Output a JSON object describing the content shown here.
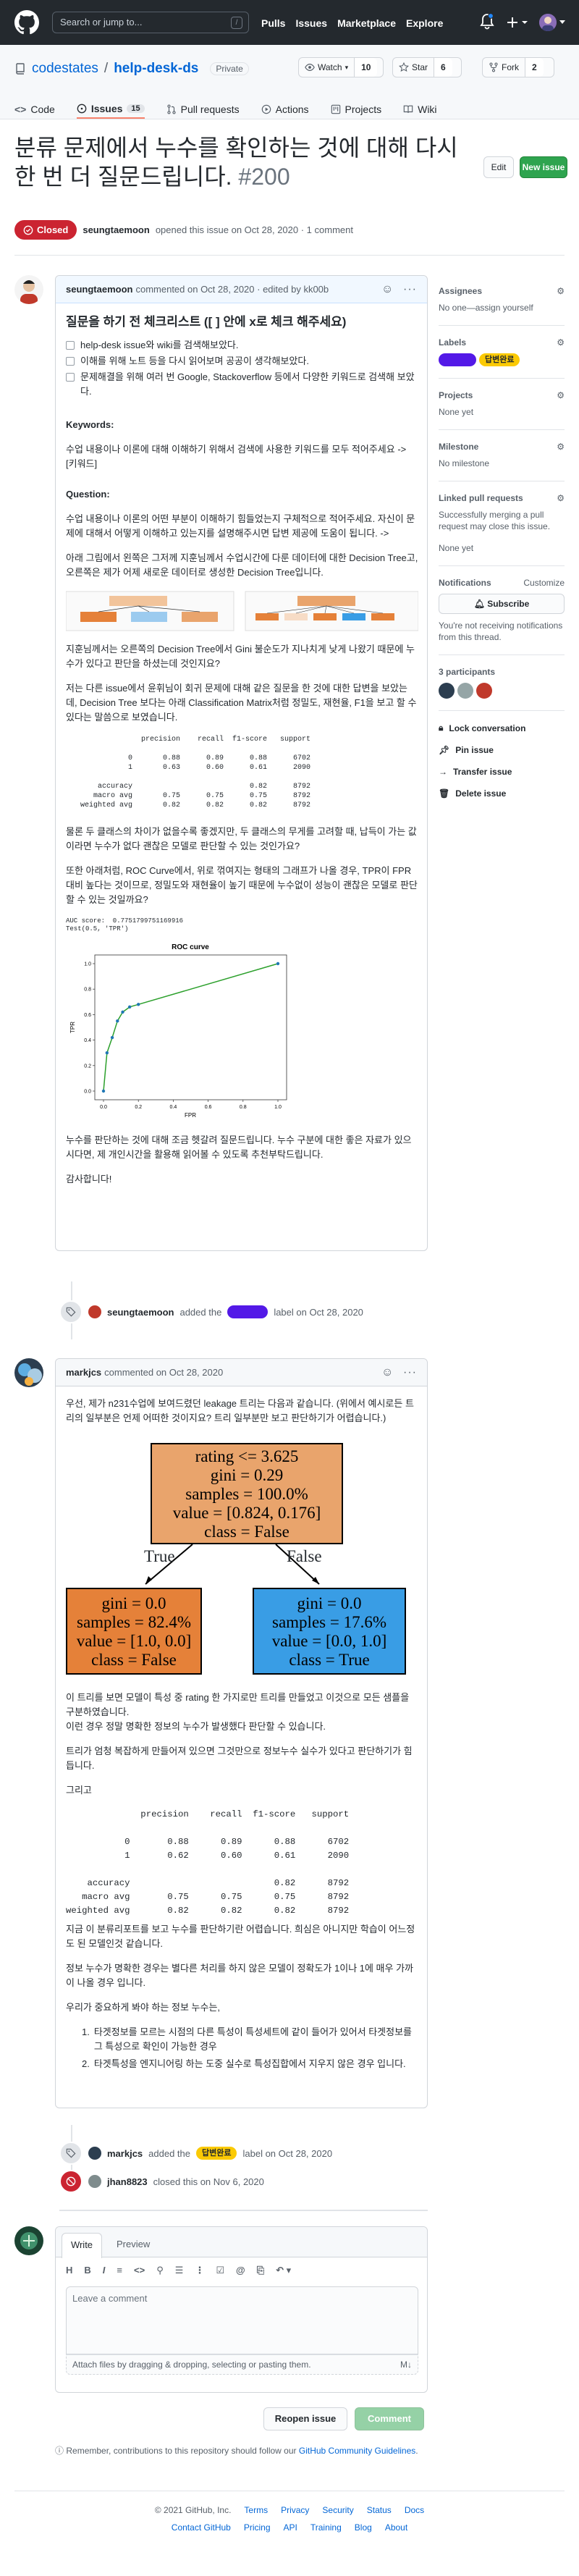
{
  "header": {
    "search_placeholder": "Search or jump to...",
    "slash_key": "/",
    "nav": [
      "Pulls",
      "Issues",
      "Marketplace",
      "Explore"
    ]
  },
  "repo": {
    "owner": "codestates",
    "separator": "/",
    "name": "help-desk-ds",
    "visibility": "Private",
    "watch_label": "Watch",
    "watch_count": "10",
    "star_label": "Star",
    "star_count": "6",
    "fork_label": "Fork",
    "fork_count": "2",
    "tabs": [
      {
        "label": "Code",
        "count": ""
      },
      {
        "label": "Issues",
        "count": "15"
      },
      {
        "label": "Pull requests",
        "count": ""
      },
      {
        "label": "Actions",
        "count": ""
      },
      {
        "label": "Projects",
        "count": ""
      },
      {
        "label": "Wiki",
        "count": ""
      }
    ]
  },
  "issue": {
    "title": "분류 문제에서 누수를 확인하는 것에 대해 다시한 번 더 질문드립니다.",
    "number": "#200",
    "edit_label": "Edit",
    "new_issue_label": "New issue",
    "state": "Closed",
    "author": "seungtaemoon",
    "meta": "opened this issue on Oct 28, 2020 · 1 comment"
  },
  "comment1": {
    "author": "seungtaemoon",
    "meta": "commented on Oct 28, 2020 · edited by kk00b",
    "heading": "질문을 하기 전 체크리스트 ([ ] 안에 x로 체크 해주세요)",
    "checklist": [
      "help-desk issue와 wiki를 검색해보았다.",
      "이해를 위해 노트 등을 다시 읽어보며 공공이 생각해보았다.",
      "문제해결을 위해 여러 번 Google, Stackoverflow 등에서 다양한 키워드로 검색해 보았다."
    ],
    "keywords_label": "Keywords:",
    "keywords_text": "수업 내용이나 이론에 대해 이해하기 위해서 검색에 사용한 키워드를 모두 적어주세요 -> [키워드]",
    "question_label": "Question:",
    "q1": "수업 내용이나 이론의 어떤 부분이 이해하기 힘들었는지 구체적으로 적어주세요. 자신이 문제에 대해서 어떻게 이해하고 있는지를 설명해주시면 답변 제공에 도움이 됩니다. ->",
    "q2": "아래 그림에서 왼쪽은 그저께 지훈님께서 수업시간에 다룬 데이터에 대한 Decision Tree고, 오른쪽은 제가 어제 새로운 데이터로 생성한 Decision Tree입니다.",
    "q3": "지훈님께서는 오른쪽의 Decision Tree에서 Gini 불순도가 지나치게 낮게 나왔기 때문에 누수가 있다고 판단을 하셨는데 것인지요?",
    "q4": "저는 다른 issue에서 윤휘님이 회귀 문제에 대해 같은 질문을 한 것에 대한 답변을 보았는데, Decision Tree 보다는 아래 Classification Matrix처럼 정밀도, 재현율, F1을 보고 할 수 있다는 말씀으로 보였습니다.",
    "report": "              precision    recall  f1-score   support\n\n           0       0.88      0.89      0.88      6702\n           1       0.63      0.60      0.61      2090\n\n    accuracy                           0.82      8792\n   macro avg       0.75      0.75      0.75      8792\nweighted avg       0.82      0.82      0.82      8792",
    "q5": "물론 두 클래스의 차이가 없을수록 좋겠지만, 두 클래스의 무게를 고려할 때, 납득이 가는 값이라면 누수가 없다 괜찮은 모델로 판단할 수 있는 것인가요?",
    "q6": "또한 아래처럼, ROC Curve에서, 위로 꺾여지는 형태의 그래프가 나올 경우, TPR이 FPR대비 높다는 것이므로, 정밀도와 재현율이 높기 때문에 누수없이 성능이 괜찮은 모델로 판단할 수 있는 것일까요?",
    "roc_output": "AUC score:  0.7751799751169916\nTest(0.5, 'TPR')",
    "q7": "누수를 판단하는 것에 대해 조금 헷갈려 질문드립니다. 누수 구분에 대한 좋은 자료가 있으시다면, 제 개인시간을 활용해 읽어볼 수 있도록 추천부탁드립니다.",
    "thanks": "감사합니다!"
  },
  "roc_chart": {
    "chart_data": {
      "type": "line",
      "title": "ROC curve",
      "xlabel": "FPR",
      "ylabel": "TPR",
      "xlim": [
        0,
        1
      ],
      "ylim": [
        0,
        1
      ],
      "xticks": [
        "0.0",
        "0.2",
        "0.4",
        "0.6",
        "0.8",
        "1.0"
      ],
      "yticks": [
        "0.0",
        "0.2",
        "0.4",
        "0.6",
        "0.8",
        "1.0"
      ],
      "x": [
        0.0,
        0.02,
        0.05,
        0.08,
        0.11,
        0.15,
        0.2,
        1.0
      ],
      "y": [
        0.0,
        0.3,
        0.42,
        0.55,
        0.62,
        0.66,
        0.68,
        1.0
      ],
      "grid": false
    }
  },
  "event1": {
    "actor": "seungtaemoon",
    "text_before": "added the",
    "text_after": "label on Oct 28, 2020"
  },
  "comment2": {
    "author": "markjcs",
    "meta": "commented on Oct 28, 2020",
    "p1": "우선, 제가 n231수업에 보여드렸던 leakage 트리는 다음과 같습니다. (위에서 예시로든 트리의 일부분은 언제 어떠한 것이지요? 트리 일부분만 보고 판단하기가 어렵습니다.)",
    "tree_root": [
      "rating <= 3.625",
      "gini = 0.29",
      "samples = 100.0%",
      "value = [0.824, 0.176]",
      "class = False"
    ],
    "tree_true": "True",
    "tree_false": "False",
    "tree_left": [
      "gini = 0.0",
      "samples = 82.4%",
      "value = [1.0, 0.0]",
      "class = False"
    ],
    "tree_right": [
      "gini = 0.0",
      "samples = 17.6%",
      "value = [0.0, 1.0]",
      "class = True"
    ],
    "p2": "이 트리를 보면 모델이 특성 중 rating 한 가지로만 트리를 만들었고 이것으로 모든 샘플을 구분하였습니다.",
    "p2b": "이런 경우 정말 명확한 정보의 누수가 발생했다 판단할 수 있습니다.",
    "p3": "트리가 엄청 복잡하게 만들어져 있으면 그것만으로 정보누수 실수가 있다고 판단하기가 힘듭니다.",
    "p4": "그리고",
    "report": "              precision    recall  f1-score   support\n\n           0       0.88      0.89      0.88      6702\n           1       0.62      0.60      0.61      2090\n\n    accuracy                           0.82      8792\n   macro avg       0.75      0.75      0.75      8792\nweighted avg       0.82      0.82      0.82      8792",
    "p5": "지금 이 분류리포트를 보고 누수를 판단하기란 어렵습니다. 희심은 아니지만 학습이 어느정도 된 모델인것 같습니다.",
    "p6": "정보 누수가 명확한 경우는 별다른 처리를 하지 않은 모델이 정확도가 1이나 1에 매우 가까이 나올 경우 입니다.",
    "p7": "우리가 중요하게 봐야 하는 정보 누수는,",
    "list": [
      "타겟정보를 모르는 시점의 다른 특성이 특성세트에 같이 들어가 있어서 타겟정보를 그 특성으로 확인이 가능한 경우",
      "타겟특성을 엔지니어링 하는 도중 실수로 특성집합에서 지우지 않은 경우 입니다."
    ]
  },
  "event2": {
    "actor": "markjcs",
    "text_before": "added the",
    "label": "답변완료",
    "text_after": "label on Oct 28, 2020"
  },
  "event3": {
    "actor": "jhan8823",
    "text": "closed this on Nov 6, 2020"
  },
  "compose": {
    "tab_write": "Write",
    "tab_preview": "Preview",
    "placeholder": "Leave a comment",
    "attach_text": "Attach files by dragging & dropping, selecting or pasting them.",
    "reopen_label": "Reopen issue",
    "comment_label": "Comment",
    "note": "Remember, contributions to this repository should follow our",
    "note_link": "GitHub Community Guidelines"
  },
  "sidebar": {
    "assignees_h": "Assignees",
    "assignees_v": "No one—assign yourself",
    "labels_h": "Labels",
    "label_answer": "답변완료",
    "projects_h": "Projects",
    "projects_v": "None yet",
    "milestone_h": "Milestone",
    "milestone_v": "No milestone",
    "linked_h": "Linked pull requests",
    "linked_v": "Successfully merging a pull request may close this issue.",
    "linked_v2": "None yet",
    "notif_h": "Notifications",
    "notif_customize": "Customize",
    "subscribe": "Subscribe",
    "notif_v": "You're not receiving notifications from this thread.",
    "participants_h": "3 participants",
    "lock": "Lock conversation",
    "pin": "Pin issue",
    "transfer": "Transfer issue",
    "delete": "Delete issue"
  },
  "footer": {
    "copyright": "© 2021 GitHub, Inc.",
    "row1": [
      "Terms",
      "Privacy",
      "Security",
      "Status",
      "Docs"
    ],
    "row2": [
      "Contact GitHub",
      "Pricing",
      "API",
      "Training",
      "Blog",
      "About"
    ]
  },
  "colors": {
    "label_purple": "#5319e7",
    "label_answer_bg": "#fbca04",
    "closed_red": "#cb2431",
    "green": "#2ea44f",
    "tree_orange_light": "#e9a46c",
    "tree_orange": "#e58139",
    "tree_blue": "#399de5"
  }
}
